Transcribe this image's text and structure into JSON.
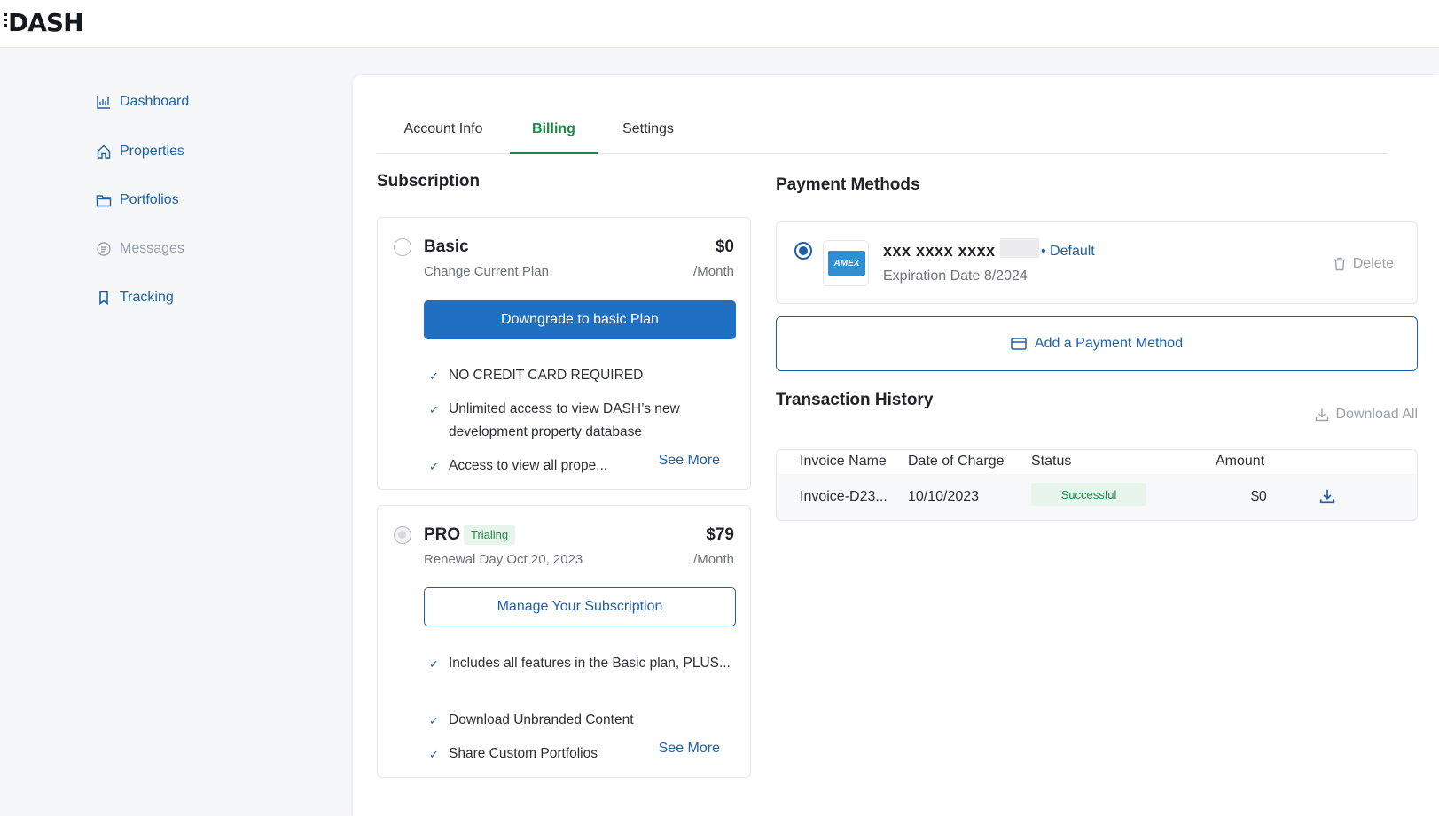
{
  "app": {
    "logo": "DASH"
  },
  "sidebar": {
    "items": [
      {
        "label": "Dashboard",
        "icon": "chart-icon"
      },
      {
        "label": "Properties",
        "icon": "home-icon"
      },
      {
        "label": "Portfolios",
        "icon": "folder-icon"
      },
      {
        "label": "Messages",
        "icon": "message-icon"
      },
      {
        "label": "Tracking",
        "icon": "bookmark-icon"
      }
    ]
  },
  "tabs": [
    "Account Info",
    "Billing",
    "Settings"
  ],
  "active_tab": "Billing",
  "subscription": {
    "title": "Subscription",
    "basic": {
      "name": "Basic",
      "price": "$0",
      "sub": "Change Current Plan",
      "per": "/Month",
      "button": "Downgrade to basic Plan",
      "features": [
        "NO CREDIT CARD REQUIRED",
        "Unlimited access to view DASH’s new development property database",
        "Access to view all prope..."
      ],
      "see_more": "See More"
    },
    "pro": {
      "name": "PRO",
      "badge": "Trialing",
      "price": "$79",
      "sub": "Renewal Day Oct 20, 2023",
      "per": "/Month",
      "button": "Manage Your Subscription",
      "features": [
        "Includes all features in the Basic plan, PLUS...",
        "Download Unbranded Content",
        "Share Custom Portfolios"
      ],
      "see_more": "See More"
    }
  },
  "payment": {
    "title": "Payment Methods",
    "card_brand": "AMEX",
    "card_number": "xxx xxxx xxxx",
    "default_label": "• Default",
    "expiration": "Expiration Date 8/2024",
    "delete_label": "Delete",
    "add_label": "Add a Payment Method"
  },
  "transactions": {
    "title": "Transaction History",
    "download_all": "Download All",
    "columns": [
      "Invoice Name",
      "Date of Charge",
      "Status",
      "Amount"
    ],
    "rows": [
      {
        "invoice": "Invoice-D23...",
        "date": "10/10/2023",
        "status": "Successful",
        "amount": "$0"
      }
    ]
  },
  "colors": {
    "accent": "#1e5fa8",
    "primary_button": "#1f6fc3",
    "success": "#1d8a48",
    "success_bg": "#e8f5ec"
  }
}
